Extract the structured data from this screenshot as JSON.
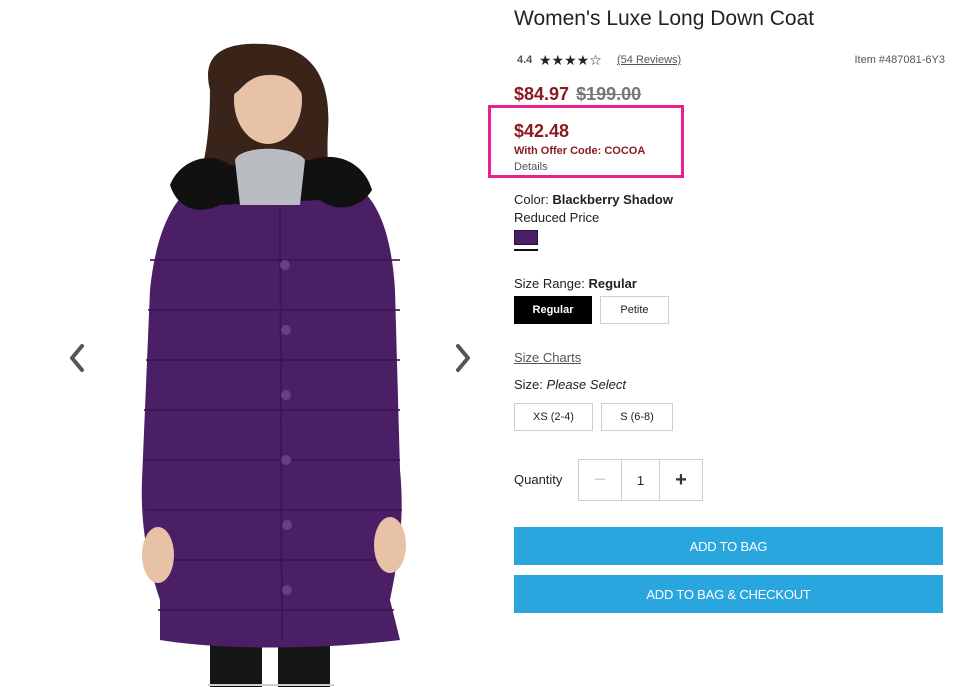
{
  "product": {
    "title": "Women's Luxe Long Down Coat",
    "rating": "4.4",
    "stars_display": "★★★★☆",
    "reviews_link": "(54 Reviews)",
    "item_number": "Item #487081-6Y3"
  },
  "pricing": {
    "sale_price": "$84.97",
    "original_price": "$199.00",
    "offer_price": "$42.48",
    "offer_code": "With Offer Code: COCOA",
    "offer_details_link": "Details",
    "price_color": "#8b1a1f",
    "highlight_color": "#ec1e8c"
  },
  "color": {
    "label": "Color:",
    "value": "Blackberry Shadow",
    "note": "Reduced Price",
    "swatch_hex": "#4b1f66"
  },
  "size_range": {
    "label": "Size Range:",
    "value": "Regular",
    "options": [
      "Regular",
      "Petite"
    ],
    "selected": "Regular"
  },
  "size": {
    "charts_link": "Size Charts",
    "label": "Size:",
    "value": "Please Select",
    "options": [
      "XS (2-4)",
      "S (6-8)"
    ]
  },
  "quantity": {
    "label": "Quantity",
    "value": "1",
    "minus": "−",
    "plus": "+"
  },
  "actions": {
    "add_to_bag": "ADD TO BAG",
    "add_to_bag_checkout": "ADD TO BAG & CHECKOUT",
    "button_color": "#2aa6de"
  },
  "gallery": {
    "prev_icon": "chevron-left-icon",
    "next_icon": "chevron-right-icon",
    "coat_color": "#4b1f66"
  }
}
